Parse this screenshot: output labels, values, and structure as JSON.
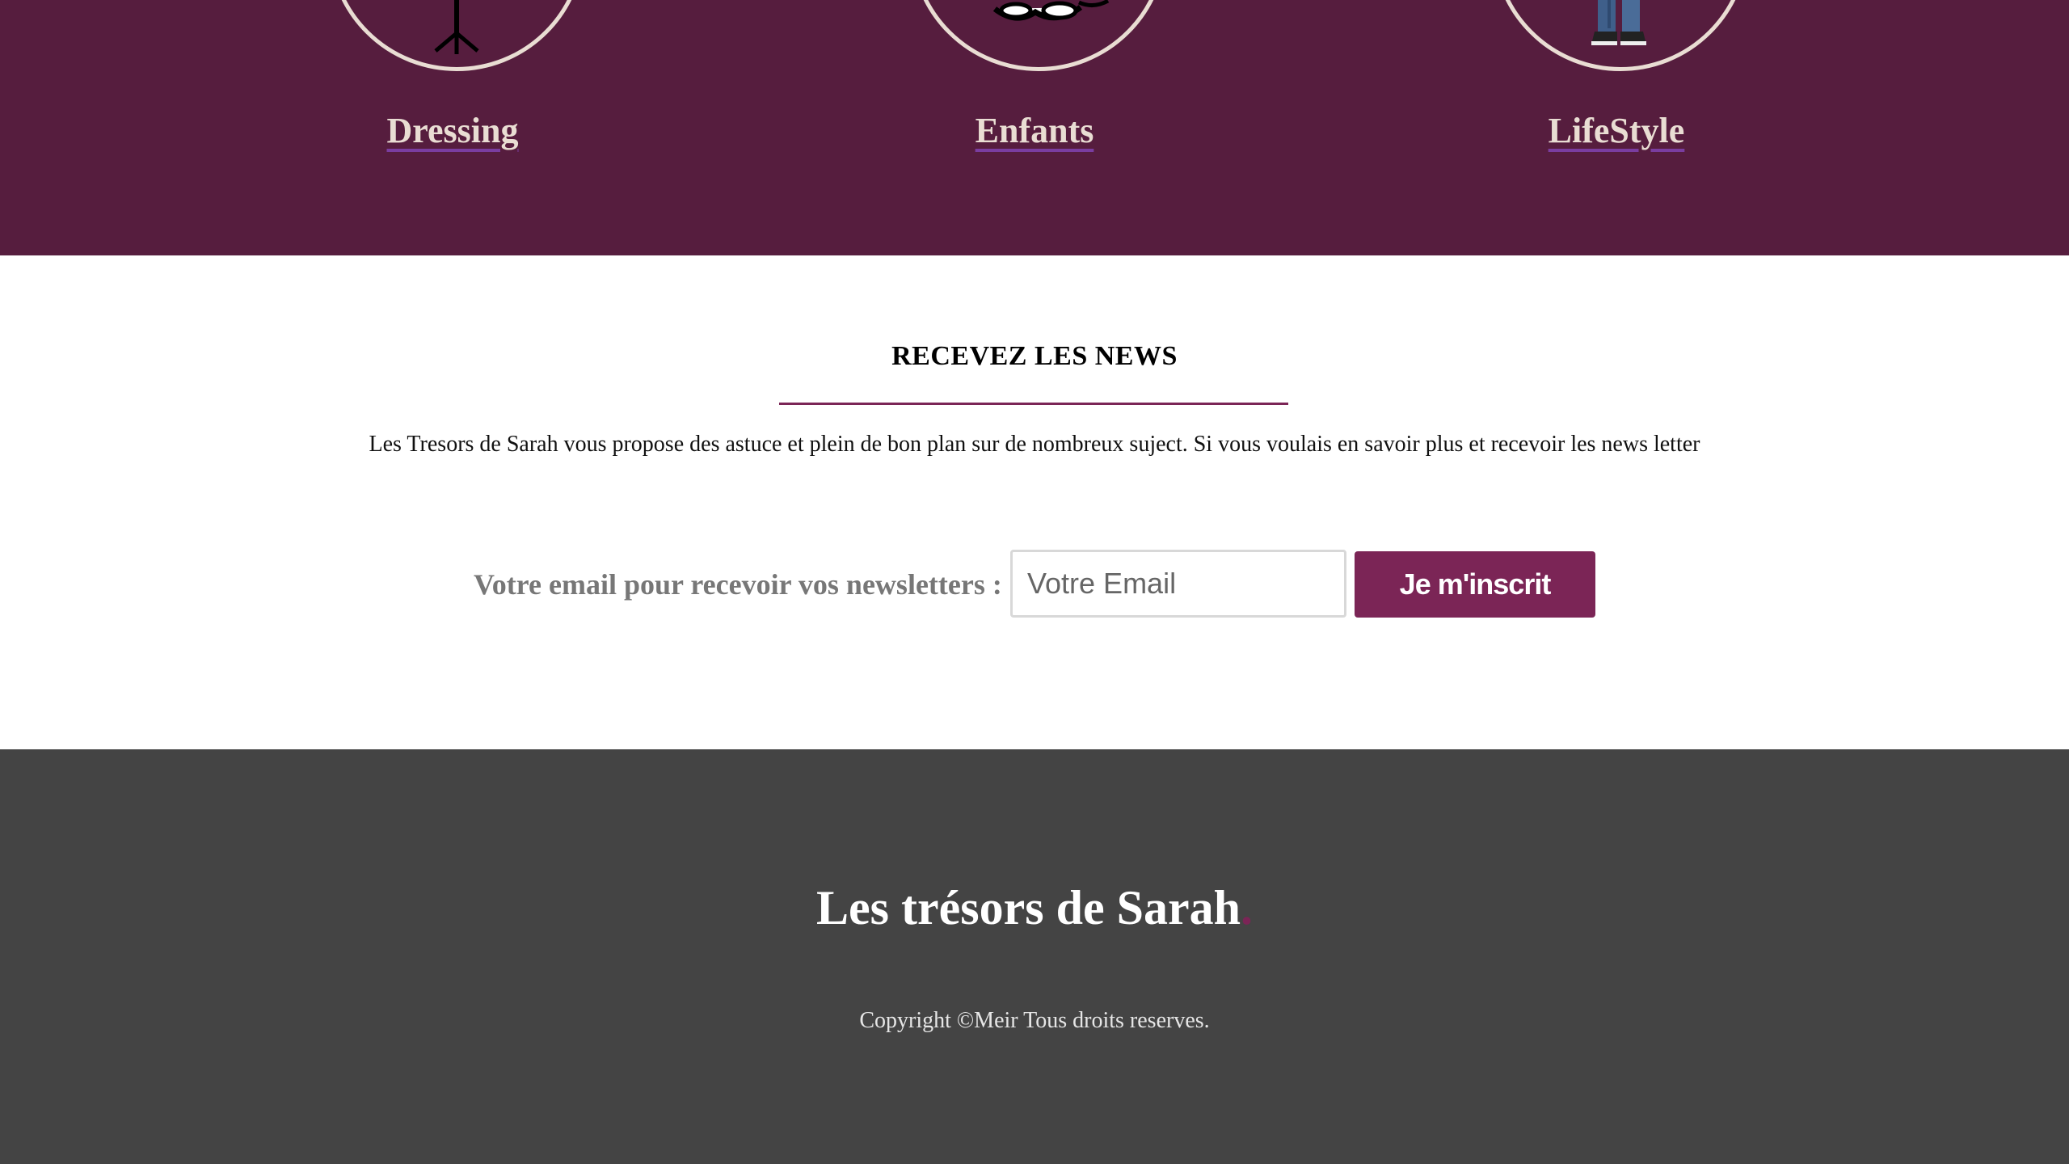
{
  "categories": {
    "items": [
      {
        "label": "Dressing",
        "icon": "clothes-rack-icon"
      },
      {
        "label": "Enfants",
        "icon": "children-icon"
      },
      {
        "label": "LifeStyle",
        "icon": "person-jeans-icon"
      }
    ]
  },
  "newsletter": {
    "title": "RECEVEZ LES NEWS",
    "text": "Les Tresors de Sarah vous propose des astuce et plein de bon plan sur de nombreux suject. Si vous voulais en savoir plus et recevoir les news letter",
    "form_label": "Votre email pour recevoir vos newsletters :",
    "email_placeholder": "Votre Email",
    "email_value": "",
    "submit_label": "Je m'inscrit"
  },
  "footer": {
    "brand": "Les trésors de Sarah",
    "brand_dot": ".",
    "copyright": "Copyright ©Meir Tous droits reserves."
  },
  "colors": {
    "category_bg": "#561d3e",
    "accent": "#7b2556",
    "footer_bg": "#444444",
    "category_text": "#e9ddd3"
  }
}
